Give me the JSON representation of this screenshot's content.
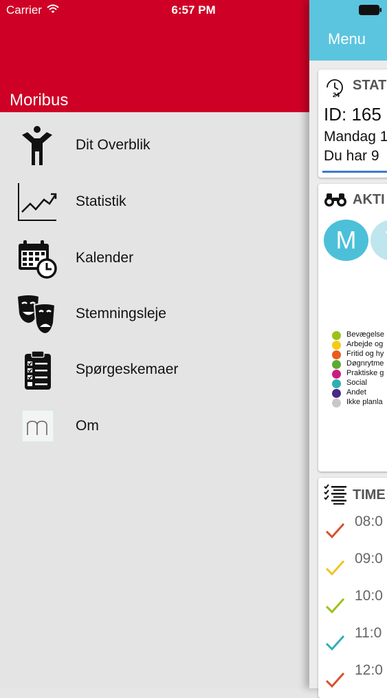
{
  "status_bar": {
    "carrier": "Carrier",
    "time": "6:57 PM"
  },
  "menu": {
    "title": "Moribus",
    "items": [
      {
        "label": "Dit Overblik",
        "icon": "person-icon"
      },
      {
        "label": "Statistik",
        "icon": "line-chart-icon"
      },
      {
        "label": "Kalender",
        "icon": "calendar-clock-icon"
      },
      {
        "label": "Stemningsleje",
        "icon": "theater-masks-icon"
      },
      {
        "label": "Spørgeskemaer",
        "icon": "clipboard-checklist-icon"
      },
      {
        "label": "Om",
        "icon": "moribus-logo-icon"
      }
    ]
  },
  "main": {
    "nav_button": "Menu",
    "status_card": {
      "title": "STAT",
      "id_line": "ID: 165",
      "day_line": "Mandag 1",
      "info_line": "Du har 9"
    },
    "activity_card": {
      "title": "AKTI",
      "bubbles": [
        {
          "letter": "M",
          "color": "#4cc0d9"
        },
        {
          "letter": "T",
          "color": "#bfe5ee"
        }
      ],
      "legend": [
        {
          "label": "Bevægelse",
          "color": "#9cc21a"
        },
        {
          "label": "Arbejde og",
          "color": "#f4cc12"
        },
        {
          "label": "Fritid og hy",
          "color": "#ea5b1c"
        },
        {
          "label": "Døgnrytme",
          "color": "#5aab32"
        },
        {
          "label": "Praktiske g",
          "color": "#cc1b7f"
        },
        {
          "label": "Social",
          "color": "#30aeb3"
        },
        {
          "label": "Andet",
          "color": "#4a2884"
        },
        {
          "label": "Ikke planla",
          "color": "#c8c8c8"
        }
      ]
    },
    "timeline_card": {
      "title": "TIME",
      "rows": [
        {
          "time": "08:0",
          "check_color": "#d8502a"
        },
        {
          "time": "09:0",
          "check_color": "#f0c420"
        },
        {
          "time": "10:0",
          "check_color": "#9cc21a"
        },
        {
          "time": "11:0",
          "check_color": "#30aeb3"
        },
        {
          "time": "12:0",
          "check_color": "#d8502a"
        }
      ]
    }
  }
}
